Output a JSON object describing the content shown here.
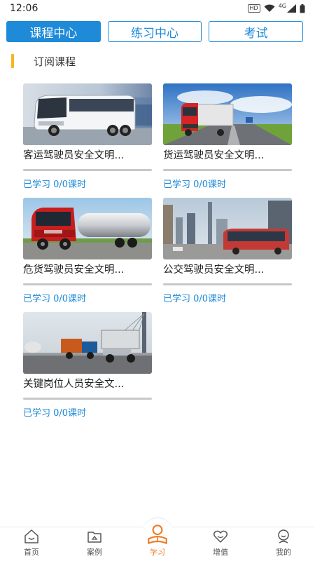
{
  "status_bar": {
    "time": "12:06",
    "hd_label": "HD",
    "network_label": "4G"
  },
  "tabs": [
    {
      "label": "课程中心",
      "active": true
    },
    {
      "label": "练习中心",
      "active": false
    },
    {
      "label": "考试",
      "active": false
    }
  ],
  "section": {
    "title": "订阅课程"
  },
  "courses": [
    {
      "title": "客运驾驶员安全文明...",
      "status": "已学习 0/0课时",
      "progress": 0,
      "image": "coach-bus"
    },
    {
      "title": "货运驾驶员安全文明...",
      "status": "已学习 0/0课时",
      "progress": 0,
      "image": "red-freight-truck"
    },
    {
      "title": "危货驾驶员安全文明...",
      "status": "已学习 0/0课时",
      "progress": 0,
      "image": "tanker-truck"
    },
    {
      "title": "公交驾驶员安全文明...",
      "status": "已学习 0/0课时",
      "progress": 0,
      "image": "city-bus"
    },
    {
      "title": "关键岗位人员安全文...",
      "status": "已学习 0/0课时",
      "progress": 0,
      "image": "cargo-trucks-bridge"
    }
  ],
  "bottom_nav": [
    {
      "label": "首页",
      "icon": "home-icon",
      "active": false
    },
    {
      "label": "案例",
      "icon": "case-folder-icon",
      "active": false
    },
    {
      "label": "学习",
      "icon": "study-reader-icon",
      "active": true
    },
    {
      "label": "增值",
      "icon": "heart-icon",
      "active": false
    },
    {
      "label": "我的",
      "icon": "profile-icon",
      "active": false
    }
  ],
  "colors": {
    "primary": "#1e8ad8",
    "accent": "#f5b81c",
    "active_nav": "#f07a22"
  }
}
